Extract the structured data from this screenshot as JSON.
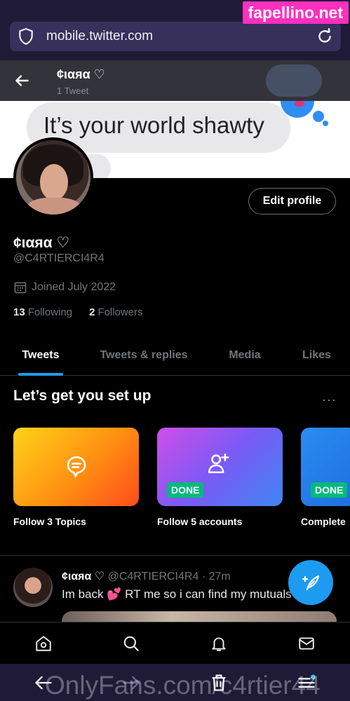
{
  "watermark_top": "fapellino.net",
  "browser": {
    "url": "mobile.twitter.com"
  },
  "header": {
    "name": "¢ιαяα ♡",
    "tweet_count": "1 Tweet"
  },
  "banner": {
    "text": "It’s your world shawty"
  },
  "profile": {
    "edit_label": "Edit profile",
    "name": "¢ιαяα ♡",
    "handle": "@C4RTIERCI4R4",
    "joined": "Joined July 2022",
    "following_count": "13",
    "following_label": "Following",
    "followers_count": "2",
    "followers_label": "Followers"
  },
  "tabs": [
    {
      "label": "Tweets"
    },
    {
      "label": "Tweets & replies"
    },
    {
      "label": "Media"
    },
    {
      "label": "Likes"
    }
  ],
  "setup": {
    "title": "Let’s get you set up",
    "more": "···",
    "cards": [
      {
        "label": "Follow 3 Topics",
        "icon": "topic-icon"
      },
      {
        "label": "Follow 5 accounts",
        "badge": "DONE",
        "icon": "add-person-icon"
      },
      {
        "label": "Complete",
        "badge": "DONE"
      }
    ]
  },
  "tweet": {
    "name": "¢ιαяα ♡",
    "handle": "@C4RTIERCI4R4",
    "time": "· 27m",
    "text": "Im back",
    "emoji": "💕",
    "text2": "RT me so i can find my mutuals"
  },
  "bottom_watermark": "OnlyFans.com/c4rtier44",
  "colors": {
    "accent": "#1d9bf0",
    "done": "#00ba7c",
    "browser": "#1f1a36"
  }
}
